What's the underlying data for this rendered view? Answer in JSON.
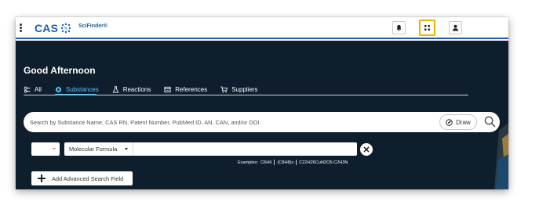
{
  "header": {
    "logo_text": "CAS",
    "product_name": "SciFinder®",
    "icons": [
      "menu-kebab-icon",
      "notifications-bell-icon",
      "apps-grid-icon",
      "user-account-icon"
    ]
  },
  "main": {
    "greeting": "Good Afternoon",
    "tabs": [
      {
        "label": "All",
        "icon": "all-search-icon",
        "active": false
      },
      {
        "label": "Substances",
        "icon": "substance-icon",
        "active": true
      },
      {
        "label": "Reactions",
        "icon": "flask-icon",
        "active": false
      },
      {
        "label": "References",
        "icon": "document-icon",
        "active": false
      },
      {
        "label": "Suppliers",
        "icon": "cart-icon",
        "active": false
      }
    ],
    "search": {
      "placeholder": "Search by Substance Name, CAS RN, Patent Number, PubMed ID, AN, CAN, and/or DOI.",
      "draw_label": "Draw"
    },
    "advanced": {
      "operator_value": "",
      "field_value": "Molecular Formula",
      "formula_value": "",
      "examples_label": "Examples:",
      "examples": [
        "C6H6",
        "(C8H8)x",
        "C22H26CuN2O5.C2H3N"
      ],
      "add_field_label": "Add Advanced Search Field"
    }
  },
  "colors": {
    "brand_blue": "#1f5fa8",
    "panel_bg": "#0e1e2d",
    "active_tab": "#5fc3ee",
    "focus_highlight": "#e8b400"
  }
}
